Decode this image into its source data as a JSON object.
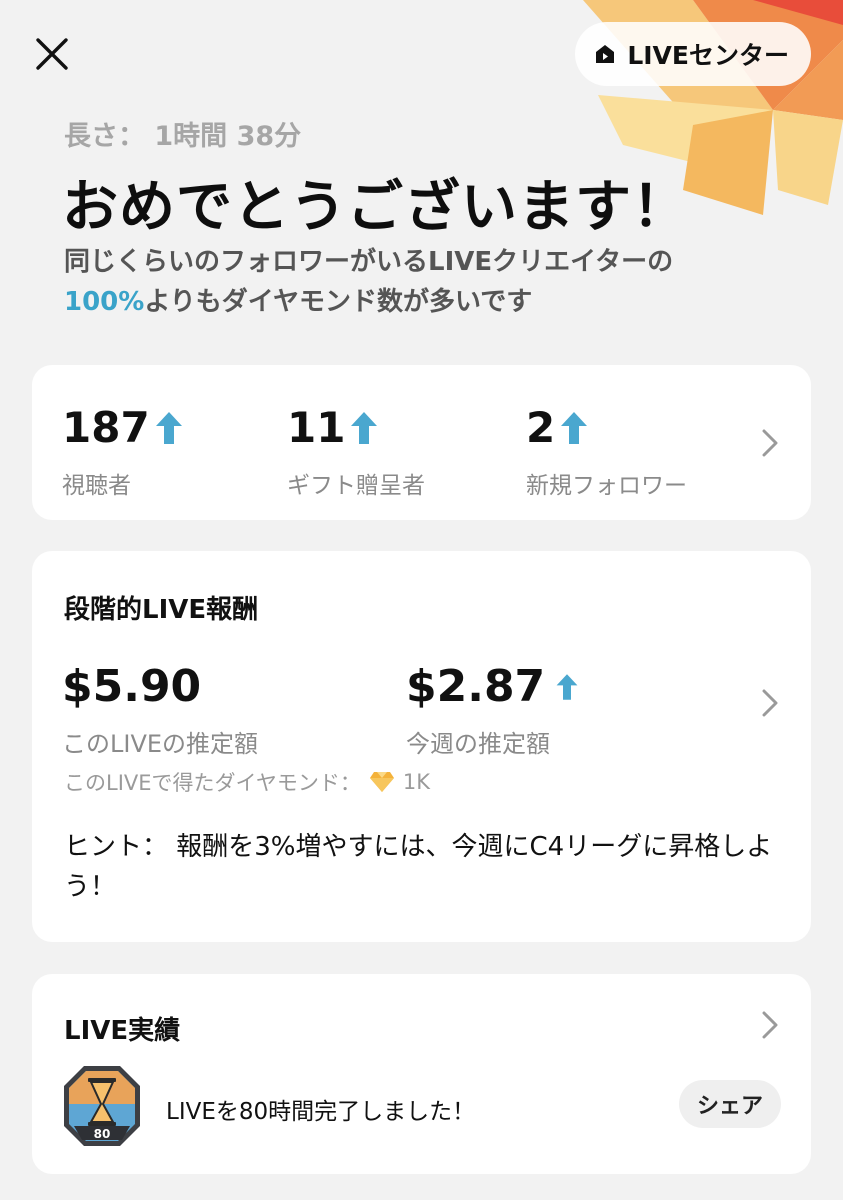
{
  "header": {
    "live_center_label": "LIVEセンター",
    "duration": "長さ： 1時間 38分",
    "headline": "おめでとうございます！",
    "subline_part1": "同じくらいのフォロワーがいるLIVEクリエイターの",
    "subline_percent": "100%",
    "subline_part2": "よりもダイヤモンド数が多いです"
  },
  "stats": [
    {
      "value": "187",
      "label": "視聴者"
    },
    {
      "value": "11",
      "label": "ギフト贈呈者"
    },
    {
      "value": "2",
      "label": "新規フォロワー"
    }
  ],
  "rewards": {
    "title": "段階的LIVE報酬",
    "this_live_value": "$5.90",
    "this_live_label": "このLIVEの推定額",
    "this_week_value": "$2.87",
    "this_week_label": "今週の推定額",
    "diamonds_label": "このLIVEで得たダイヤモンド：",
    "diamonds_value": "1K",
    "hint": "ヒント： 報酬を3%増やすには、今週にC4リーグに昇格しよう！"
  },
  "achievements": {
    "title": "LIVE実績",
    "badge_number": "80",
    "text": "LIVEを80時間完了しました！",
    "share_label": "シェア"
  },
  "colors": {
    "accent_blue": "#4aa7cf",
    "percent_blue": "#3aa3c9",
    "background": "#f2f2f2",
    "burst_orange": "#f2b55e",
    "burst_red": "#ea5a45"
  },
  "icons": {
    "close": "close-icon",
    "live_center": "home-icon",
    "stat_trend": "arrow-up-icon",
    "chevron": "chevron-right-icon",
    "diamond": "diamond-icon",
    "badge": "hourglass-badge-icon"
  }
}
